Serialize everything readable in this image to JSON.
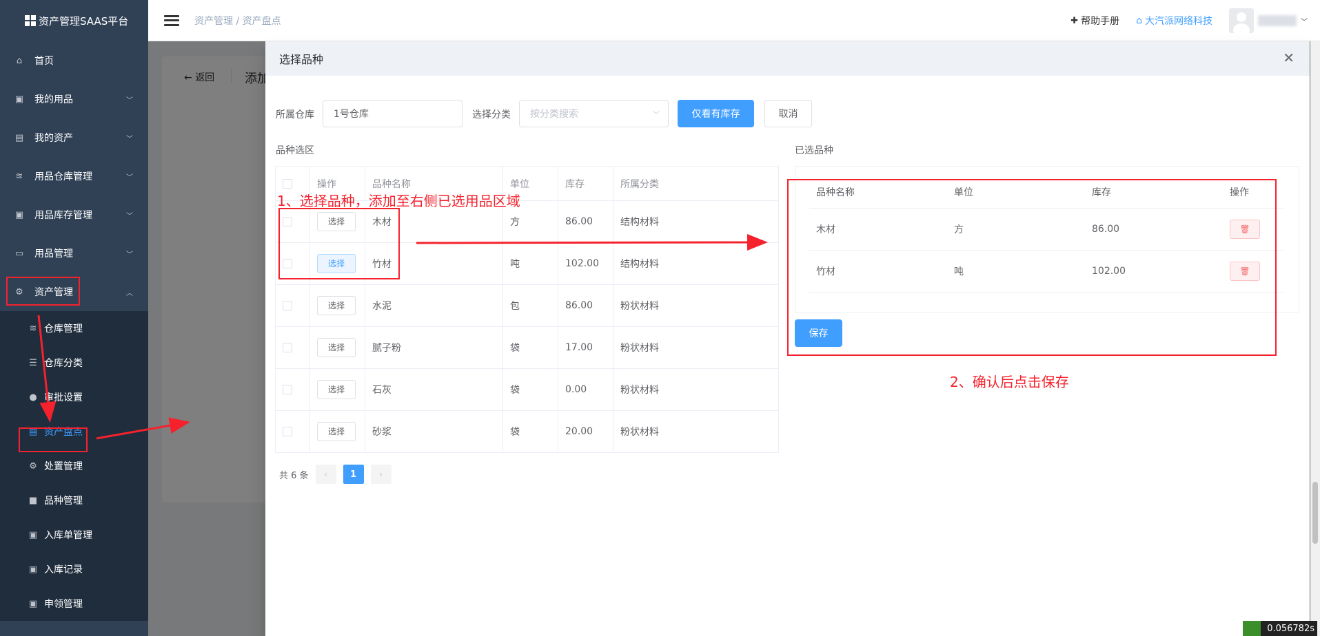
{
  "sidebar": {
    "brand": "资产管理SAAS平台",
    "items": [
      {
        "label": "首页",
        "icon": "home-icon"
      },
      {
        "label": "我的用品",
        "icon": "bag-icon"
      },
      {
        "label": "我的资产",
        "icon": "building-icon"
      },
      {
        "label": "用品仓库管理",
        "icon": "database-icon"
      },
      {
        "label": "用品库存管理",
        "icon": "box-icon"
      },
      {
        "label": "用品管理",
        "icon": "inbox-icon"
      },
      {
        "label": "资产管理",
        "icon": "gear-icon"
      }
    ],
    "sub_items": [
      {
        "label": "仓库管理",
        "icon": "database-icon"
      },
      {
        "label": "仓库分类",
        "icon": "sliders-icon"
      },
      {
        "label": "审批设置",
        "icon": "user-icon"
      },
      {
        "label": "资产盘点",
        "icon": "document-icon"
      },
      {
        "label": "处置管理",
        "icon": "gear-icon"
      },
      {
        "label": "品种管理",
        "icon": "lock-icon"
      },
      {
        "label": "入库单管理",
        "icon": "clipboard-icon"
      },
      {
        "label": "入库记录",
        "icon": "clipboard-icon"
      },
      {
        "label": "申领管理",
        "icon": "clipboard-icon"
      }
    ]
  },
  "header": {
    "breadcrumb": "资产管理 / 资产盘点",
    "help": "帮助手册",
    "company": "大汽派网络科技"
  },
  "background": {
    "back": "返回",
    "title": "添加盘"
  },
  "drawer": {
    "title": "选择品种",
    "warehouse_label": "所属仓库",
    "warehouse_value": "1号仓库",
    "category_label": "选择分类",
    "category_placeholder": "按分类搜索",
    "only_stock_btn": "仅看有库存",
    "cancel_btn": "取消",
    "left_title": "品种选区",
    "right_title": "已选品种",
    "left_headers": [
      "操作",
      "品种名称",
      "单位",
      "库存",
      "所属分类"
    ],
    "select_label": "选择",
    "rows": [
      {
        "name": "木材",
        "unit": "方",
        "stock": "86.00",
        "category": "结构材料"
      },
      {
        "name": "竹材",
        "unit": "吨",
        "stock": "102.00",
        "category": "结构材料"
      },
      {
        "name": "水泥",
        "unit": "包",
        "stock": "86.00",
        "category": "粉状材料"
      },
      {
        "name": "腻子粉",
        "unit": "袋",
        "stock": "17.00",
        "category": "粉状材料"
      },
      {
        "name": "石灰",
        "unit": "袋",
        "stock": "0.00",
        "category": "粉状材料"
      },
      {
        "name": "砂浆",
        "unit": "袋",
        "stock": "20.00",
        "category": "粉状材料"
      }
    ],
    "right_headers": [
      "品种名称",
      "单位",
      "库存",
      "操作"
    ],
    "selected": [
      {
        "name": "木材",
        "unit": "方",
        "stock": "86.00"
      },
      {
        "name": "竹材",
        "unit": "吨",
        "stock": "102.00"
      }
    ],
    "save_btn": "保存",
    "total": "共 6 条",
    "page": "1"
  },
  "annotations": {
    "step1": "1、选择品种，添加至右侧已选用品区域",
    "step2": "2、确认后点击保存"
  },
  "perf": "0.056782s"
}
